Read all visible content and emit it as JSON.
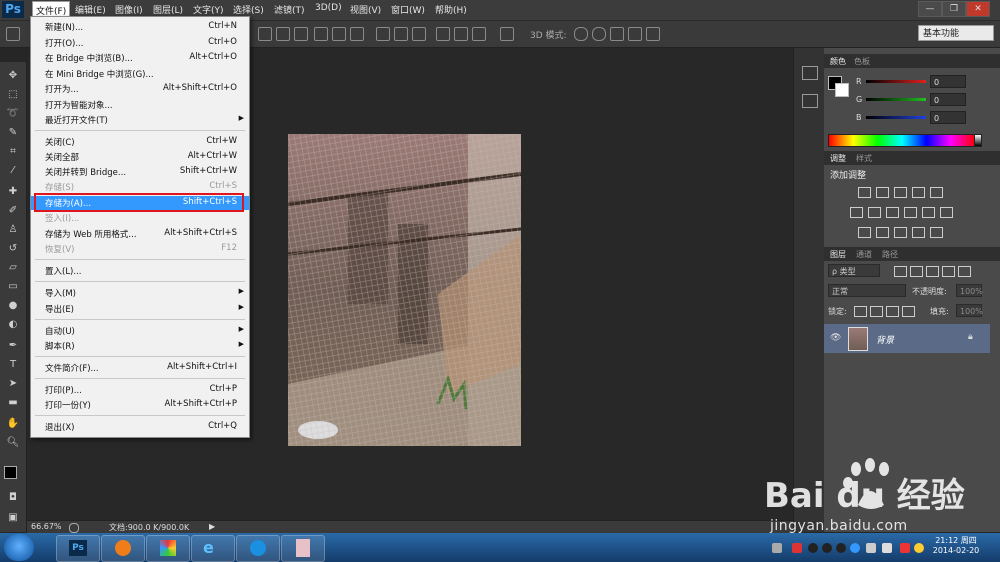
{
  "app": {
    "logo": "Ps"
  },
  "menubar": {
    "items": [
      "文件(F)",
      "编辑(E)",
      "图像(I)",
      "图层(L)",
      "文字(Y)",
      "选择(S)",
      "滤镜(T)",
      "3D(D)",
      "视图(V)",
      "窗口(W)",
      "帮助(H)"
    ],
    "active": "文件(F)"
  },
  "window_controls": {
    "minimize": "—",
    "restore": "❐",
    "close": "✕"
  },
  "options_bar": {
    "mode_3d_label": "3D 模式:",
    "workspace": "基本功能"
  },
  "file_menu": {
    "items": [
      {
        "label": "新建(N)...",
        "shortcut": "Ctrl+N"
      },
      {
        "label": "打开(O)...",
        "shortcut": "Ctrl+O"
      },
      {
        "label": "在 Bridge 中浏览(B)...",
        "shortcut": "Alt+Ctrl+O"
      },
      {
        "label": "在 Mini Bridge 中浏览(G)...",
        "shortcut": ""
      },
      {
        "label": "打开为...",
        "shortcut": "Alt+Shift+Ctrl+O"
      },
      {
        "label": "打开为智能对象...",
        "shortcut": ""
      },
      {
        "label": "最近打开文件(T)",
        "shortcut": ""
      },
      {
        "label": "关闭(C)",
        "shortcut": "Ctrl+W"
      },
      {
        "label": "关闭全部",
        "shortcut": "Alt+Ctrl+W"
      },
      {
        "label": "关闭并转到 Bridge...",
        "shortcut": "Shift+Ctrl+W"
      },
      {
        "label": "存储(S)",
        "shortcut": "Ctrl+S"
      },
      {
        "label": "存储为(A)...",
        "shortcut": "Shift+Ctrl+S"
      },
      {
        "label": "签入(I)...",
        "shortcut": ""
      },
      {
        "label": "存储为 Web 所用格式...",
        "shortcut": "Alt+Shift+Ctrl+S"
      },
      {
        "label": "恢复(V)",
        "shortcut": "F12"
      },
      {
        "label": "置入(L)...",
        "shortcut": ""
      },
      {
        "label": "导入(M)",
        "shortcut": ""
      },
      {
        "label": "导出(E)",
        "shortcut": ""
      },
      {
        "label": "自动(U)",
        "shortcut": ""
      },
      {
        "label": "脚本(R)",
        "shortcut": ""
      },
      {
        "label": "文件简介(F)...",
        "shortcut": "Alt+Shift+Ctrl+I"
      },
      {
        "label": "打印(P)...",
        "shortcut": "Ctrl+P"
      },
      {
        "label": "打印一份(Y)",
        "shortcut": "Alt+Shift+Ctrl+P"
      },
      {
        "label": "退出(X)",
        "shortcut": "Ctrl+Q"
      }
    ],
    "highlighted": "存储为(A)..."
  },
  "color_panel": {
    "tabs": [
      "颜色",
      "色板"
    ],
    "channels": [
      {
        "label": "R",
        "value": "0"
      },
      {
        "label": "G",
        "value": "0"
      },
      {
        "label": "B",
        "value": "0"
      }
    ],
    "slider_colors": [
      "#e02020",
      "#20c020",
      "#2040e0"
    ]
  },
  "adjustments_panel": {
    "tabs": [
      "调整",
      "样式"
    ],
    "title": "添加调整"
  },
  "layers_panel": {
    "tabs": [
      "图层",
      "通道",
      "路径"
    ],
    "filter": "ρ 类型",
    "blend_mode": "正常",
    "opacity_label": "不透明度:",
    "opacity_value": "100%",
    "lock_label": "锁定:",
    "fill_label": "填充:",
    "fill_value": "100%",
    "layer_name": "背景"
  },
  "statusbar": {
    "zoom": "66.67%",
    "doc_size": "文档:900.0 K/900.0K"
  },
  "taskbar": {
    "time": "21:12 周四",
    "date": "2014-02-20"
  },
  "watermark": {
    "brand": "Bai du 经验",
    "url": "jingyan.baidu.com"
  }
}
